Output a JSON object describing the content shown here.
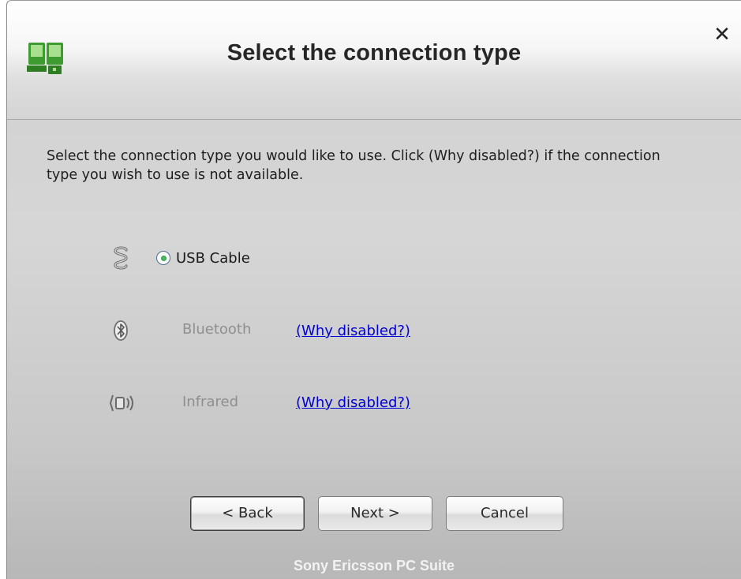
{
  "dialog": {
    "title": "Select the connection type",
    "close_glyph": "✕",
    "app_icon": "pc-phone-connection-icon",
    "instructions": "Select the connection type you would like to use. Click (Why disabled?) if the connection type you wish to use is not available."
  },
  "options": [
    {
      "label": "USB Cable",
      "icon": "usb-cable-icon",
      "enabled": true,
      "selected": true,
      "why_link": ""
    },
    {
      "label": "Bluetooth",
      "icon": "bluetooth-icon",
      "enabled": false,
      "selected": false,
      "why_link": "(Why disabled?)"
    },
    {
      "label": "Infrared",
      "icon": "infrared-icon",
      "enabled": false,
      "selected": false,
      "why_link": "(Why disabled?)"
    }
  ],
  "buttons": {
    "back": "< Back",
    "next": "Next >",
    "cancel": "Cancel"
  },
  "footer": "Sony Ericsson PC Suite",
  "colors": {
    "accent_green": "#3c9a2e",
    "link": "#0000d8",
    "disabled_text": "#8f8f8f"
  }
}
